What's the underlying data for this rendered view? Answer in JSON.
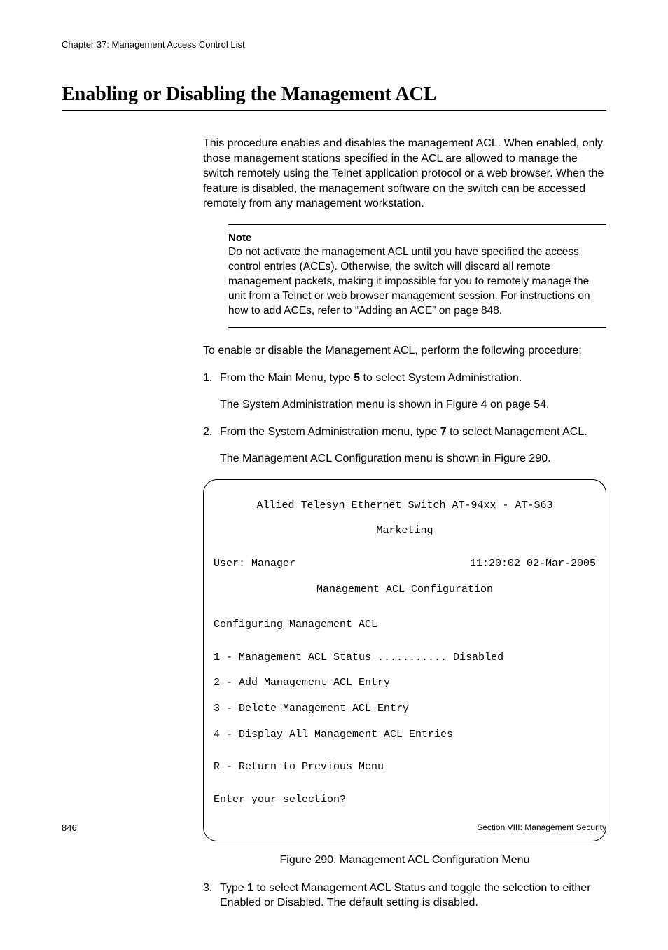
{
  "chapter": "Chapter 37: Management Access Control List",
  "title": "Enabling or Disabling the Management ACL",
  "intro": "This procedure enables and disables the management ACL. When enabled, only those management stations specified in the ACL are allowed to manage the switch remotely using the Telnet application protocol or a web browser. When the feature is disabled, the management software on the switch can be accessed remotely from any management workstation.",
  "note": {
    "label": "Note",
    "body": "Do not activate the management ACL until you have specified the access control entries (ACEs). Otherwise, the switch will discard all remote management packets, making it impossible for you to remotely manage the unit from a Telnet or web browser management session. For instructions on how to add ACEs, refer to “Adding an ACE” on page 848."
  },
  "lead": "To enable or disable the Management ACL, perform the following procedure:",
  "steps": {
    "s1": {
      "num": "1.",
      "pre": "From the Main Menu, type ",
      "bold": "5",
      "post": " to select System Administration.",
      "follow": "The System Administration menu is shown in Figure 4 on page 54."
    },
    "s2": {
      "num": "2.",
      "pre": "From the System Administration menu, type ",
      "bold": "7",
      "post": " to select Management ACL.",
      "follow": "The Management ACL Configuration menu is shown in Figure 290."
    },
    "s3": {
      "num": "3.",
      "pre": "Type ",
      "bold": "1",
      "post": " to select Management ACL Status and toggle the selection to either Enabled or Disabled. The default setting is disabled."
    }
  },
  "terminal": {
    "line1": "Allied Telesyn Ethernet Switch AT-94xx - AT-S63",
    "line2": "Marketing",
    "userLabel": "User: Manager",
    "timestamp": "11:20:02 02-Mar-2005",
    "menuTitle": "Management ACL Configuration",
    "configHeader": "Configuring Management ACL",
    "opt1": "1 - Management ACL Status ........... Disabled",
    "opt2": "2 - Add Management ACL Entry",
    "opt3": "3 - Delete Management ACL Entry",
    "opt4": "4 - Display All Management ACL Entries",
    "optR": "R - Return to Previous Menu",
    "prompt": "Enter your selection?"
  },
  "figureCaption": "Figure 290. Management ACL Configuration Menu",
  "footer": {
    "pageNum": "846",
    "section": "Section VIII: Management Security"
  }
}
